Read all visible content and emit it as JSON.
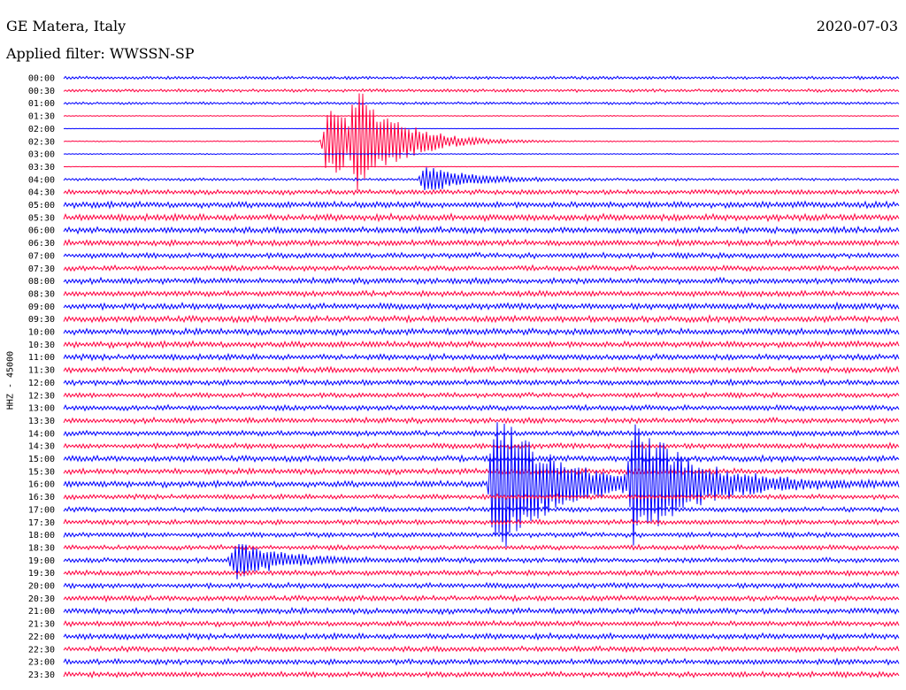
{
  "header": {
    "station": "GE Matera, Italy",
    "date": "2020-07-03",
    "filter": "Applied filter: WWSSN-SP"
  },
  "channel_label": "HHZ - 45000",
  "colors": {
    "even": "#0000ff",
    "odd": "#ff0040"
  },
  "chart_data": {
    "type": "line",
    "title": "GE Matera, Italy",
    "subtitle": "Applied filter: WWSSN-SP",
    "ylabel": "HHZ - 45000",
    "xlabel": "",
    "rows": [
      "00:00",
      "00:30",
      "01:00",
      "01:30",
      "02:00",
      "02:30",
      "03:00",
      "03:30",
      "04:00",
      "04:30",
      "05:00",
      "05:30",
      "06:00",
      "06:30",
      "07:00",
      "07:30",
      "08:00",
      "08:30",
      "09:00",
      "09:30",
      "10:00",
      "10:30",
      "11:00",
      "11:30",
      "12:00",
      "12:30",
      "13:00",
      "13:30",
      "14:00",
      "14:30",
      "15:00",
      "15:30",
      "16:00",
      "16:30",
      "17:00",
      "17:30",
      "18:00",
      "18:30",
      "19:00",
      "19:30",
      "20:00",
      "20:30",
      "21:00",
      "21:30",
      "22:00",
      "22:30",
      "23:00",
      "23:30"
    ],
    "noise_level": [
      0.35,
      0.35,
      0.3,
      0.1,
      0.05,
      0.1,
      0.12,
      0.05,
      0.3,
      0.55,
      0.7,
      0.75,
      0.7,
      0.65,
      0.6,
      0.6,
      0.65,
      0.65,
      0.7,
      0.7,
      0.7,
      0.7,
      0.65,
      0.65,
      0.6,
      0.55,
      0.6,
      0.6,
      0.6,
      0.6,
      0.65,
      0.65,
      0.7,
      0.55,
      0.55,
      0.55,
      0.55,
      0.55,
      0.55,
      0.6,
      0.6,
      0.6,
      0.65,
      0.6,
      0.65,
      0.6,
      0.6,
      0.6
    ],
    "events": [
      {
        "row": 5,
        "minute": 9.5,
        "amplitude": 3.0,
        "duration": 1.5
      },
      {
        "row": 5,
        "minute": 10.5,
        "amplitude": 3.0,
        "duration": 1.5
      },
      {
        "row": 8,
        "minute": 13.0,
        "amplitude": 1.0,
        "duration": 1.5
      },
      {
        "row": 32,
        "minute": 15.5,
        "amplitude": 6.0,
        "duration": 2.0
      },
      {
        "row": 32,
        "minute": 20.5,
        "amplitude": 5.0,
        "duration": 2.0
      },
      {
        "row": 38,
        "minute": 6.2,
        "amplitude": 1.5,
        "duration": 1.5
      }
    ]
  }
}
